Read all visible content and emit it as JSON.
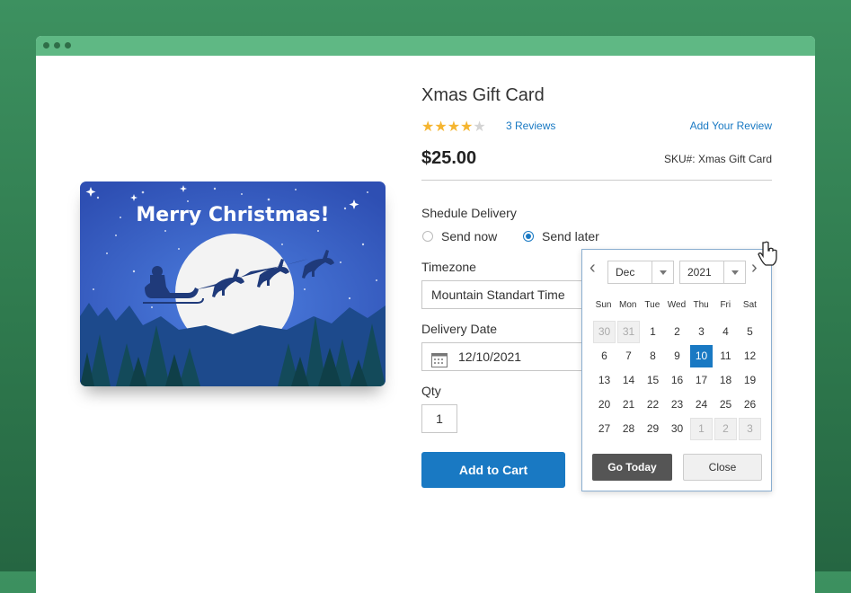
{
  "product": {
    "title": "Xmas Gift Card",
    "rating": 4,
    "rating_max": 5,
    "reviews_link": "3 Reviews",
    "add_review_link": "Add Your Review",
    "price": "$25.00",
    "sku": "SKU#: Xmas Gift Card",
    "card_text": "Merry Christmas!"
  },
  "delivery": {
    "schedule_label": "Shedule Delivery",
    "options": [
      "Send now",
      "Send later"
    ],
    "selected_option": "Send later",
    "timezone_label": "Timezone",
    "timezone_value": "Mountain Standart Time",
    "date_label": "Delivery Date",
    "date_value": "12/10/2021"
  },
  "qty": {
    "label": "Qty",
    "value": "1"
  },
  "add_to_cart": "Add to Cart",
  "calendar": {
    "month": "Dec",
    "year": "2021",
    "weekdays": [
      "Sun",
      "Mon",
      "Tue",
      "Wed",
      "Thu",
      "Fri",
      "Sat"
    ],
    "days": [
      [
        "30",
        "31",
        "1",
        "2",
        "3",
        "4",
        "5"
      ],
      [
        "6",
        "7",
        "8",
        "9",
        "10",
        "11",
        "12"
      ],
      [
        "13",
        "14",
        "15",
        "16",
        "17",
        "18",
        "19"
      ],
      [
        "20",
        "21",
        "22",
        "23",
        "24",
        "25",
        "26"
      ],
      [
        "27",
        "28",
        "29",
        "30",
        "1",
        "2",
        "3"
      ]
    ],
    "selected_day": "10",
    "go_today": "Go Today",
    "close": "Close"
  },
  "colors": {
    "accent": "#1979c3",
    "star": "#f5b530",
    "background": "#2f7a4e",
    "titlebar": "#5fb884"
  }
}
